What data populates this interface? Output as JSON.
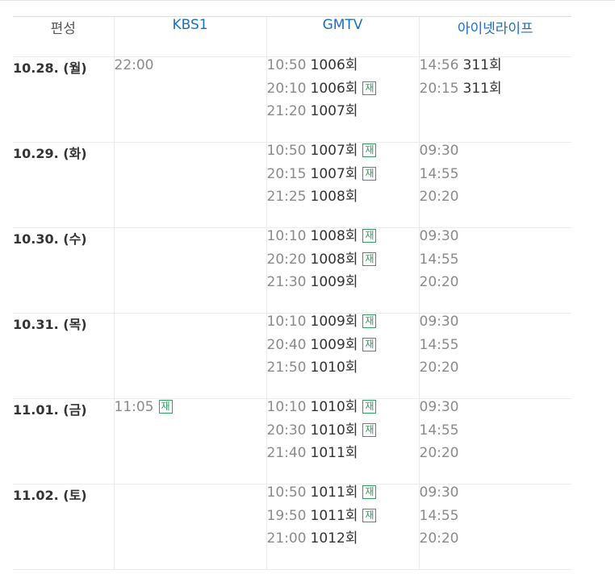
{
  "header": {
    "date_col": "편성",
    "channels": [
      "KBS1",
      "GMTV",
      "아이넷라이프"
    ]
  },
  "rerun_label": "재",
  "rows": [
    {
      "date": "10.28. (월)",
      "kbs1": [
        {
          "time": "22:00",
          "ep": "",
          "rerun": false
        }
      ],
      "gmtv": [
        {
          "time": "10:50",
          "ep": "1006회",
          "rerun": false
        },
        {
          "time": "20:10",
          "ep": "1006회",
          "rerun": true
        },
        {
          "time": "21:20",
          "ep": "1007회",
          "rerun": false
        }
      ],
      "inet": [
        {
          "time": "14:56",
          "ep": "311회",
          "rerun": false
        },
        {
          "time": "20:15",
          "ep": "311회",
          "rerun": false
        }
      ]
    },
    {
      "date": "10.29. (화)",
      "kbs1": [],
      "gmtv": [
        {
          "time": "10:50",
          "ep": "1007회",
          "rerun": true
        },
        {
          "time": "20:15",
          "ep": "1007회",
          "rerun": true
        },
        {
          "time": "21:25",
          "ep": "1008회",
          "rerun": false
        }
      ],
      "inet": [
        {
          "time": "09:30",
          "ep": "",
          "rerun": false
        },
        {
          "time": "14:55",
          "ep": "",
          "rerun": false
        },
        {
          "time": "20:20",
          "ep": "",
          "rerun": false
        }
      ]
    },
    {
      "date": "10.30. (수)",
      "kbs1": [],
      "gmtv": [
        {
          "time": "10:10",
          "ep": "1008회",
          "rerun": true
        },
        {
          "time": "20:20",
          "ep": "1008회",
          "rerun": true
        },
        {
          "time": "21:30",
          "ep": "1009회",
          "rerun": false
        }
      ],
      "inet": [
        {
          "time": "09:30",
          "ep": "",
          "rerun": false
        },
        {
          "time": "14:55",
          "ep": "",
          "rerun": false
        },
        {
          "time": "20:20",
          "ep": "",
          "rerun": false
        }
      ]
    },
    {
      "date": "10.31. (목)",
      "kbs1": [],
      "gmtv": [
        {
          "time": "10:10",
          "ep": "1009회",
          "rerun": true
        },
        {
          "time": "20:40",
          "ep": "1009회",
          "rerun": true
        },
        {
          "time": "21:50",
          "ep": "1010회",
          "rerun": false
        }
      ],
      "inet": [
        {
          "time": "09:30",
          "ep": "",
          "rerun": false
        },
        {
          "time": "14:55",
          "ep": "",
          "rerun": false
        },
        {
          "time": "20:20",
          "ep": "",
          "rerun": false
        }
      ]
    },
    {
      "date": "11.01. (금)",
      "kbs1": [
        {
          "time": "11:05",
          "ep": "",
          "rerun": true
        }
      ],
      "gmtv": [
        {
          "time": "10:10",
          "ep": "1010회",
          "rerun": true
        },
        {
          "time": "20:30",
          "ep": "1010회",
          "rerun": true
        },
        {
          "time": "21:40",
          "ep": "1011회",
          "rerun": false
        }
      ],
      "inet": [
        {
          "time": "09:30",
          "ep": "",
          "rerun": false
        },
        {
          "time": "14:55",
          "ep": "",
          "rerun": false
        },
        {
          "time": "20:20",
          "ep": "",
          "rerun": false
        }
      ]
    },
    {
      "date": "11.02. (토)",
      "kbs1": [],
      "gmtv": [
        {
          "time": "10:50",
          "ep": "1011회",
          "rerun": true
        },
        {
          "time": "19:50",
          "ep": "1011회",
          "rerun": true
        },
        {
          "time": "21:00",
          "ep": "1012회",
          "rerun": false
        }
      ],
      "inet": [
        {
          "time": "09:30",
          "ep": "",
          "rerun": false
        },
        {
          "time": "14:55",
          "ep": "",
          "rerun": false
        },
        {
          "time": "20:20",
          "ep": "",
          "rerun": false
        }
      ]
    }
  ],
  "colors": {
    "channel_link": "#1a6fc0",
    "time": "#8a8a8a",
    "rerun_badge": "#2ba15a",
    "border": "#ebebeb"
  }
}
